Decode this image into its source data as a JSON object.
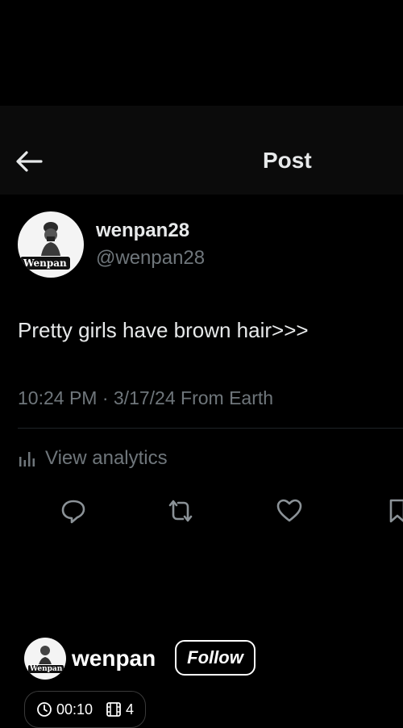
{
  "header": {
    "title": "Post",
    "back_icon": "arrow-left-icon"
  },
  "author": {
    "display_name": "wenpan28",
    "handle": "@wenpan28",
    "avatar_label": "Wenpan"
  },
  "post": {
    "text": "Pretty girls have brown hair>>>",
    "meta": "10:24 PM · 3/17/24 From Earth"
  },
  "analytics": {
    "label": "View analytics",
    "icon": "bar-chart-icon"
  },
  "actions": [
    {
      "name": "reply",
      "icon": "reply-icon"
    },
    {
      "name": "repost",
      "icon": "repost-icon"
    },
    {
      "name": "like",
      "icon": "heart-icon"
    },
    {
      "name": "bookmark",
      "icon": "bookmark-icon"
    }
  ],
  "footer": {
    "name": "wenpan",
    "avatar_label": "Wenpan",
    "follow_label": "Follow",
    "duration": "00:10",
    "clip_count": "4"
  },
  "colors": {
    "background": "#000000",
    "text_primary": "#e7e9ea",
    "text_secondary": "#6f767b"
  }
}
